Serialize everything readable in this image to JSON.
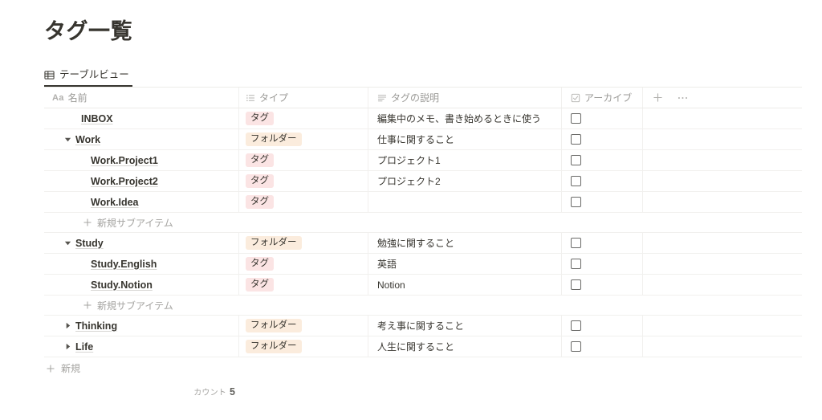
{
  "page": {
    "title": "タグ一覧"
  },
  "view_tab": {
    "label": "テーブルビュー",
    "icon": "table-view-icon"
  },
  "table": {
    "columns": [
      {
        "key": "name",
        "label": "名前",
        "icon": "title-aa-icon",
        "icon_text": "Aa"
      },
      {
        "key": "type",
        "label": "タイプ",
        "icon": "select-list-icon"
      },
      {
        "key": "desc",
        "label": "タグの説明",
        "icon": "text-lines-icon"
      },
      {
        "key": "archive",
        "label": "アーカイブ",
        "icon": "checkbox-icon"
      }
    ],
    "header_actions": {
      "add_property": "+",
      "more_options": "···"
    },
    "rows": [
      {
        "kind": "item",
        "level": 0,
        "toggle": "none",
        "name": "INBOX",
        "type": "タグ",
        "type_color": "#fbe4e4",
        "desc": "編集中のメモ、書き始めるときに使う",
        "archive_checked": false
      },
      {
        "kind": "item",
        "level": 0,
        "toggle": "expanded",
        "name": "Work",
        "type": "フォルダー",
        "type_color": "#fbecdd",
        "desc": "仕事に関すること",
        "archive_checked": false
      },
      {
        "kind": "item",
        "level": 1,
        "toggle": "none",
        "name": "Work.Project1",
        "type": "タグ",
        "type_color": "#fbe4e4",
        "desc": "プロジェクト1",
        "archive_checked": false
      },
      {
        "kind": "item",
        "level": 1,
        "toggle": "none",
        "name": "Work.Project2",
        "type": "タグ",
        "type_color": "#fbe4e4",
        "desc": "プロジェクト2",
        "archive_checked": false
      },
      {
        "kind": "item",
        "level": 1,
        "toggle": "none",
        "name": "Work.Idea",
        "type": "タグ",
        "type_color": "#fbe4e4",
        "desc": "",
        "archive_checked": false
      },
      {
        "kind": "add_subitem",
        "label": "新規サブアイテム"
      },
      {
        "kind": "item",
        "level": 0,
        "toggle": "expanded",
        "name": "Study",
        "type": "フォルダー",
        "type_color": "#fbecdd",
        "desc": "勉強に関すること",
        "archive_checked": false
      },
      {
        "kind": "item",
        "level": 1,
        "toggle": "none",
        "name": "Study.English",
        "type": "タグ",
        "type_color": "#fbe4e4",
        "desc": "英語",
        "archive_checked": false
      },
      {
        "kind": "item",
        "level": 1,
        "toggle": "none",
        "name": "Study.Notion",
        "type": "タグ",
        "type_color": "#fbe4e4",
        "desc": "Notion",
        "archive_checked": false
      },
      {
        "kind": "add_subitem",
        "label": "新規サブアイテム"
      },
      {
        "kind": "item",
        "level": 0,
        "toggle": "collapsed",
        "name": "Thinking",
        "type": "フォルダー",
        "type_color": "#fbecdd",
        "desc": "考え事に関すること",
        "archive_checked": false
      },
      {
        "kind": "item",
        "level": 0,
        "toggle": "collapsed",
        "name": "Life",
        "type": "フォルダー",
        "type_color": "#fbecdd",
        "desc": "人生に関すること",
        "archive_checked": false
      },
      {
        "kind": "new_row",
        "label": "新規"
      }
    ],
    "footer": {
      "count_label": "カウント",
      "count_value": "5"
    }
  },
  "colors": {
    "text": "#37352f",
    "muted": "#9b9a97",
    "border": "#f1f0ee",
    "tag_pill": "#fbe4e4",
    "folder_pill": "#fbecdd"
  }
}
